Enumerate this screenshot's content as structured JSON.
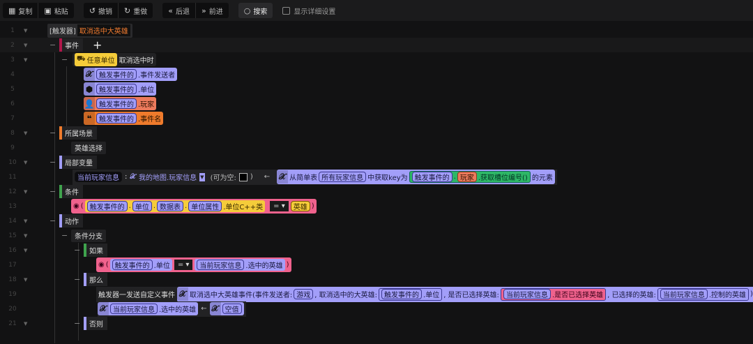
{
  "toolbar": {
    "copy": "复制",
    "paste": "粘贴",
    "undo": "撤销",
    "redo": "重做",
    "back": "后退",
    "forward": "前进",
    "search": "搜索",
    "show_details": "显示详细设置"
  },
  "rows": {
    "r1": {
      "prefix": "[触发器]",
      "name": "取消选中大英雄"
    },
    "r2": {
      "label": "事件",
      "add": "+"
    },
    "r3": {
      "unit": "任意单位",
      "event": "取消选中时"
    },
    "r4": {
      "pill": "触发事件的",
      "prop": ".事件发送者"
    },
    "r5": {
      "pill": "触发事件的",
      "prop": ".单位"
    },
    "r6": {
      "pill": "触发事件的",
      "prop": ".玩家"
    },
    "r7": {
      "pill": "触发事件的",
      "prop": ".事件名"
    },
    "r8": {
      "label": "所属场景"
    },
    "r9": {
      "text": "英雄选择"
    },
    "r10": {
      "label": "局部变量"
    },
    "r11": {
      "var": "当前玩家信息",
      "colon": ":",
      "type": "我的地图.玩家信息",
      "nullable": "(可为空:",
      "nullable_end": ")",
      "arrow": "←",
      "from": "从简单表",
      "table": "所有玩家信息",
      "getkey": "中获取key为",
      "event": "触发事件的",
      "player": "玩家",
      "slot": ".获取槽位编号()",
      "suffix": "的元素"
    },
    "r12": {
      "label": "条件"
    },
    "r13": {
      "p1": "触发事件的",
      "p2": "单位",
      "p3": "数据表",
      "p4": "单位属性",
      "prop": ".单位C++类",
      "op": "=",
      "val": "英雄"
    },
    "r14": {
      "label": "动作"
    },
    "r15": {
      "text": "条件分支"
    },
    "r16": {
      "label": "如果"
    },
    "r17": {
      "p1": "触发事件的",
      "prop": ".单位",
      "op": "=",
      "p2": "当前玩家信息",
      "prop2": ".选中的英雄"
    },
    "r18": {
      "label": "那么"
    },
    "r19": {
      "action": "触发器一发送自定义事件",
      "event": "取消选中大英雄事件(事件发送者:",
      "sender": "游戏",
      "arg1": ", 取消选中的大英雄:",
      "p1": "触发事件的",
      "prop1": ".单位",
      "arg2": ", 是否已选择英雄:",
      "p2": "当前玩家信息",
      "prop2": ".是否已选择英雄",
      "arg3": ", 已选择的英雄:",
      "p3": "当前玩家信息",
      "prop3": ".控制的英雄",
      "close": ")"
    },
    "r20": {
      "p1": "当前玩家信息",
      "prop": ".选中的英雄",
      "arrow": "←",
      "val": "空值"
    },
    "r21": {
      "label": "否则"
    }
  },
  "line_numbers": [
    "1",
    "2",
    "3",
    "4",
    "5",
    "6",
    "7",
    "8",
    "9",
    "10",
    "11",
    "12",
    "13",
    "14",
    "15",
    "16",
    "17",
    "18",
    "19",
    "20",
    "21"
  ]
}
